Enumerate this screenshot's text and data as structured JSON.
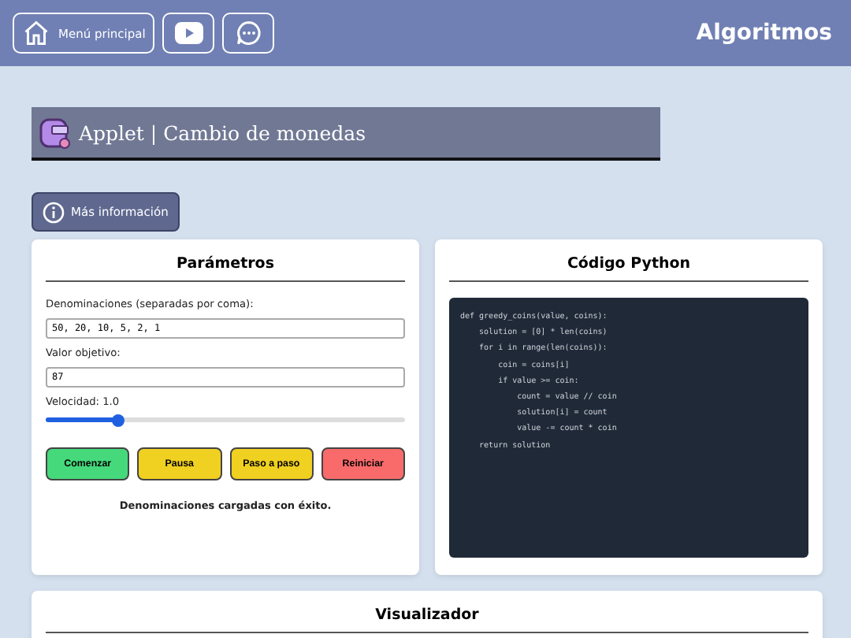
{
  "header": {
    "home_label": "Menú principal",
    "logo": "Algoritmos"
  },
  "title": "Applet | Cambio de monedas",
  "info_button": "Más información",
  "parameters": {
    "heading": "Parámetros",
    "denominations_label": "Denominaciones (separadas por coma):",
    "denominations_value": "50, 20, 10, 5, 2, 1",
    "target_label": "Valor objetivo:",
    "target_value": "87",
    "speed_label": "Velocidad: 1.0",
    "speed": {
      "level": 0.2
    },
    "buttons": [
      {
        "label": "Comenzar",
        "kind": "start"
      },
      {
        "label": "Pausa",
        "kind": "pause"
      },
      {
        "label": "Paso a paso",
        "kind": "step"
      },
      {
        "label": "Reiniciar",
        "kind": "reset"
      }
    ],
    "status": "Denominaciones cargadas con éxito."
  },
  "code": {
    "heading": "Código Python",
    "lines": [
      "def greedy_coins(value, coins):",
      "    solution = [0] * len(coins)",
      "    for i in range(len(coins)):",
      "        coin = coins[i]",
      "        if value >= coin:",
      "            count = value // coin",
      "            solution[i] = count",
      "            value -= count * coin",
      "    return solution"
    ]
  },
  "visualizer": {
    "heading": "Visualizador"
  }
}
